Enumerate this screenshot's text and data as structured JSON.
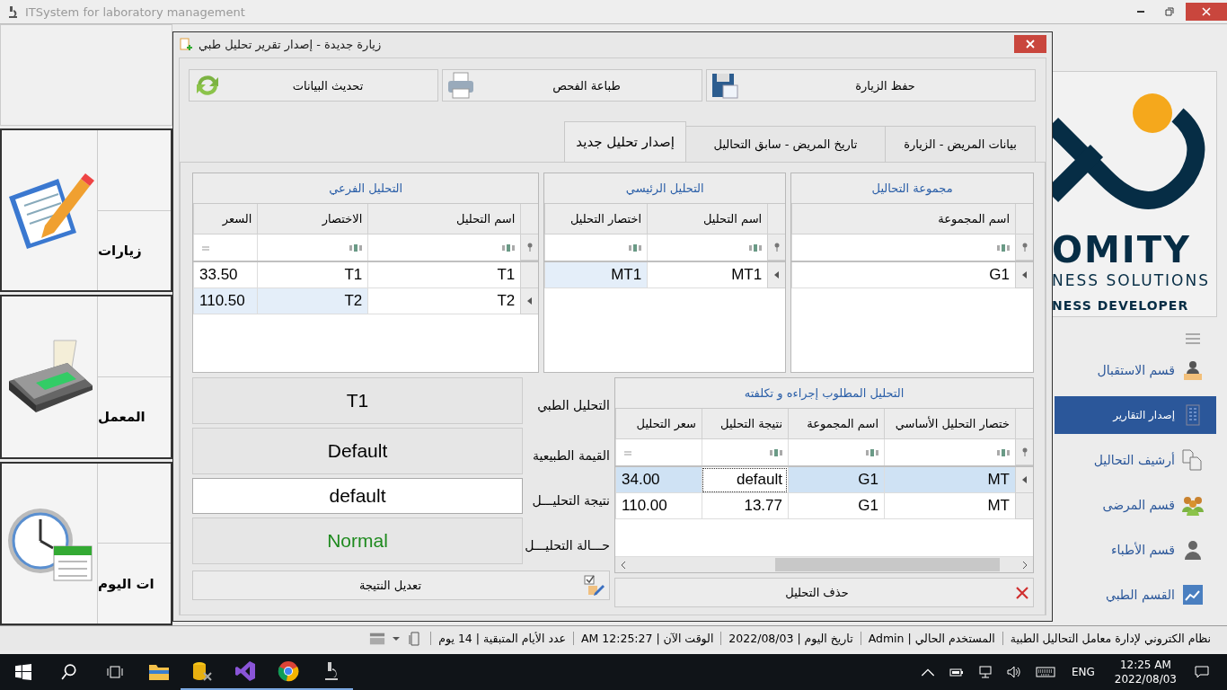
{
  "app": {
    "title": "ITSystem for laboratory management"
  },
  "tiles": [
    {
      "label": "زيارات"
    },
    {
      "label": "المعمل"
    },
    {
      "label": "ات اليوم"
    }
  ],
  "logo": {
    "lines": [
      "OMITY",
      "NESS SOLUTIONS",
      "NESS DEVELOPER"
    ]
  },
  "menu": [
    {
      "label": "قسم الاستقبال",
      "selected": false
    },
    {
      "label": "إصدار التقارير",
      "selected": true
    },
    {
      "label": "أرشيف التحاليل",
      "selected": false
    },
    {
      "label": "قسم المرضى",
      "selected": false
    },
    {
      "label": "قسم الأطباء",
      "selected": false
    },
    {
      "label": "القسم الطبي",
      "selected": false
    }
  ],
  "dialog": {
    "title": "زيارة جديدة - إصدار تقرير تحليل طبي",
    "toolbar": [
      "حفظ الزيارة",
      "طباعة الفحص",
      "تحديث البيانات"
    ],
    "tabs": [
      {
        "label": "بيانات المريض - الزيارة",
        "selected": false
      },
      {
        "label": "تاريخ المريض - سابق التحاليل",
        "selected": false
      },
      {
        "label": "إصدار تحليل جديد",
        "selected": true
      }
    ],
    "grids": [
      {
        "caption": "مجموعة التحاليل",
        "columns": [
          {
            "label": "اسم المجموعة",
            "kind": "text",
            "focused": true
          }
        ],
        "rows": [
          {
            "cells": [
              "G1"
            ],
            "selected": true
          }
        ]
      },
      {
        "caption": "التحليل الرئيسي",
        "columns": [
          {
            "label": "اسم التحليل",
            "kind": "text",
            "focused": true
          },
          {
            "label": "اختصار التحليل",
            "kind": "text",
            "focused": false
          }
        ],
        "rows": [
          {
            "cells": [
              "MT1",
              "MT1"
            ],
            "selected": true
          }
        ]
      },
      {
        "caption": "التحليل الفرعي",
        "columns": [
          {
            "label": "اسم التحليل",
            "kind": "text",
            "focused": true
          },
          {
            "label": "الاختصار",
            "kind": "text",
            "focused": false
          },
          {
            "label": "السعر",
            "kind": "number",
            "focused": false
          }
        ],
        "rows": [
          {
            "cells": [
              "T1",
              "T1",
              "33.50"
            ],
            "selected": false
          },
          {
            "cells": [
              "T2",
              "T2",
              "110.50"
            ],
            "selected": true
          }
        ]
      }
    ],
    "order": {
      "caption": "التحليل المطلوب إجراءه و تكلفته",
      "columns": [
        {
          "label": "ختصار التحليل الأساسي",
          "kind": "text",
          "focused": false
        },
        {
          "label": "اسم المجموعة",
          "kind": "text",
          "focused": false
        },
        {
          "label": "نتيجة التحليل",
          "kind": "text",
          "focused": true
        },
        {
          "label": "سعر التحليل",
          "kind": "number",
          "focused": false
        }
      ],
      "rows": [
        {
          "cells": [
            "MT",
            "G1",
            "default",
            "34.00"
          ],
          "selected": true
        },
        {
          "cells": [
            "MT",
            "G1",
            "13.77",
            "110.00"
          ],
          "selected": false
        }
      ]
    },
    "fields": [
      {
        "label": "التحليل الطبي",
        "value": "T1",
        "kind": "readonly"
      },
      {
        "label": "القيمة الطبيعية",
        "value": "Default",
        "kind": "readonly"
      },
      {
        "label": "نتيجة التحليـــل",
        "value": "default",
        "kind": "input"
      },
      {
        "label": "حـــالة التحليـــل",
        "value": "Normal",
        "kind": "status"
      }
    ],
    "edit_button": "تعديل النتيجة",
    "delete_button": "حذف التحليل"
  },
  "status_bar": [
    "نظام الكتروني لإدارة معامل التحاليل الطبية",
    "المستخدم الحالي | Admin",
    "تاريخ اليوم | 2022/08/03",
    "الوقت الآن | 12:25:27 AM",
    "عدد الأيام المتبقية | 14 يوم"
  ],
  "taskbar": {
    "apps": [
      {
        "running": false
      },
      {
        "running": true
      },
      {
        "running": true
      },
      {
        "running": true
      },
      {
        "running": true
      }
    ],
    "language": "ENG",
    "time": "12:25 AM",
    "date": "2022/08/03"
  }
}
